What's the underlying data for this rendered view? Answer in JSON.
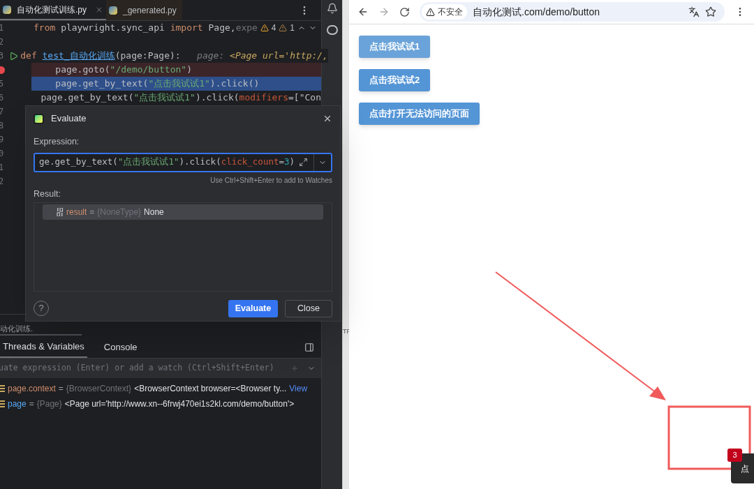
{
  "editor": {
    "tabs": [
      {
        "label": "自动化测试训练.py",
        "selected": true,
        "closable": true
      },
      {
        "label": "_generated.py",
        "selected": false,
        "closable": false
      }
    ],
    "inspection": {
      "warnings": "4",
      "weak_warnings": "1"
    },
    "lines": [
      {
        "number": "1",
        "breakpoint": false,
        "current": false,
        "run": false,
        "segments": [
          {
            "kind": "kw",
            "t": "from "
          },
          {
            "kind": "plain",
            "t": "playwright.sync_api "
          },
          {
            "kind": "kw",
            "t": "import "
          },
          {
            "kind": "plain",
            "t": "Page,"
          },
          {
            "kind": "dim",
            "t": "expe"
          }
        ]
      },
      {
        "number": "2",
        "breakpoint": false,
        "run": false
      },
      {
        "number": "3",
        "breakpoint": false,
        "current": false,
        "run": true,
        "segments": [
          {
            "kind": "kw",
            "t": "def "
          },
          {
            "kind": "fn",
            "t": "test_自动化训练"
          },
          {
            "kind": "plain",
            "t": "(page:Page):"
          },
          {
            "kind": "hint",
            "t": "   page: "
          },
          {
            "kind": "hintval",
            "t": "<Page url='http:/,"
          }
        ]
      },
      {
        "breakpoint": true,
        "current": false,
        "run": false,
        "segments": [
          {
            "kind": "plain",
            "t": "    page.goto("
          },
          {
            "kind": "str",
            "t": "\"/demo/button\""
          },
          {
            "kind": "plain",
            "t": ")"
          }
        ]
      },
      {
        "number": "5",
        "breakpoint": false,
        "current": true,
        "run": false,
        "segments": [
          {
            "kind": "plain",
            "t": "    page.get_by_text("
          },
          {
            "kind": "str",
            "t": "\"点击我试试1\""
          },
          {
            "kind": "plain",
            "t": ").click()"
          }
        ]
      },
      {
        "number": "6",
        "breakpoint": false,
        "current": false,
        "run": false,
        "segments": [
          {
            "kind": "plain",
            "t": "    page.get_by_text("
          },
          {
            "kind": "str",
            "t": "\"点击我试试1\""
          },
          {
            "kind": "plain",
            "t": ").click("
          },
          {
            "kind": "param",
            "t": "modifiers"
          },
          {
            "kind": "plain",
            "t": "=[\"Con"
          }
        ]
      },
      {
        "number": "7",
        "breakpoint": false,
        "run": false
      },
      {
        "number": "8",
        "breakpoint": false,
        "run": false
      },
      {
        "number": "9",
        "breakpoint": false,
        "run": false
      },
      {
        "number": "0",
        "breakpoint": false,
        "run": false
      },
      {
        "number": "1",
        "breakpoint": false,
        "run": false
      },
      {
        "number": "2",
        "breakpoint": false,
        "run": false
      }
    ]
  },
  "evaluate_dialog": {
    "title": "Evaluate",
    "expression_label": "Expression:",
    "expression": [
      {
        "kind": "plain",
        "t": "ge.get_by_text("
      },
      {
        "kind": "str",
        "t": "\"点击我试试1\""
      },
      {
        "kind": "plain",
        "t": ").click("
      },
      {
        "kind": "param",
        "t": "click_count"
      },
      {
        "kind": "plain",
        "t": "="
      },
      {
        "kind": "num",
        "t": "3"
      },
      {
        "kind": "plain",
        "t": ")"
      }
    ],
    "hint": "Use Ctrl+Shift+Enter to add to Watches",
    "result_label": "Result:",
    "result": {
      "name": "result",
      "eq": "=",
      "type": "{NoneType}",
      "value": "None"
    },
    "buttons": [
      {
        "label": "Evaluate",
        "primary": true
      },
      {
        "label": "Close",
        "primary": false
      }
    ],
    "help": "?"
  },
  "debug_panel": {
    "session_tab": "动化训练.",
    "tabs": [
      {
        "label": "Threads & Variables",
        "selected": true
      },
      {
        "label": "Console",
        "selected": false
      }
    ],
    "watch_placeholder": "uate expression (Enter) or add a watch (Ctrl+Shift+Enter)",
    "variables": [
      {
        "name": "page.context",
        "kind": "field",
        "eq": "=",
        "type": "{BrowserContext}",
        "value": "<BrowserContext browser=<Browser ty...",
        "link": "View"
      },
      {
        "name": "page",
        "kind": "local",
        "eq": "=",
        "type": "{Page}",
        "value": "<Page url='http://www.xn--6frwj470ei1s2kl.com/demo/button'>"
      }
    ]
  },
  "side_text": "TF",
  "browser": {
    "security": "不安全",
    "url": "自动化测试.com/demo/button",
    "buttons": [
      {
        "label": "点击我试试1",
        "hovered": true
      },
      {
        "label": "点击我试试2",
        "hovered": false
      },
      {
        "label": "点击打开无法访问的页面",
        "hovered": false
      }
    ],
    "toast": {
      "badge": "3",
      "text": "点"
    }
  }
}
